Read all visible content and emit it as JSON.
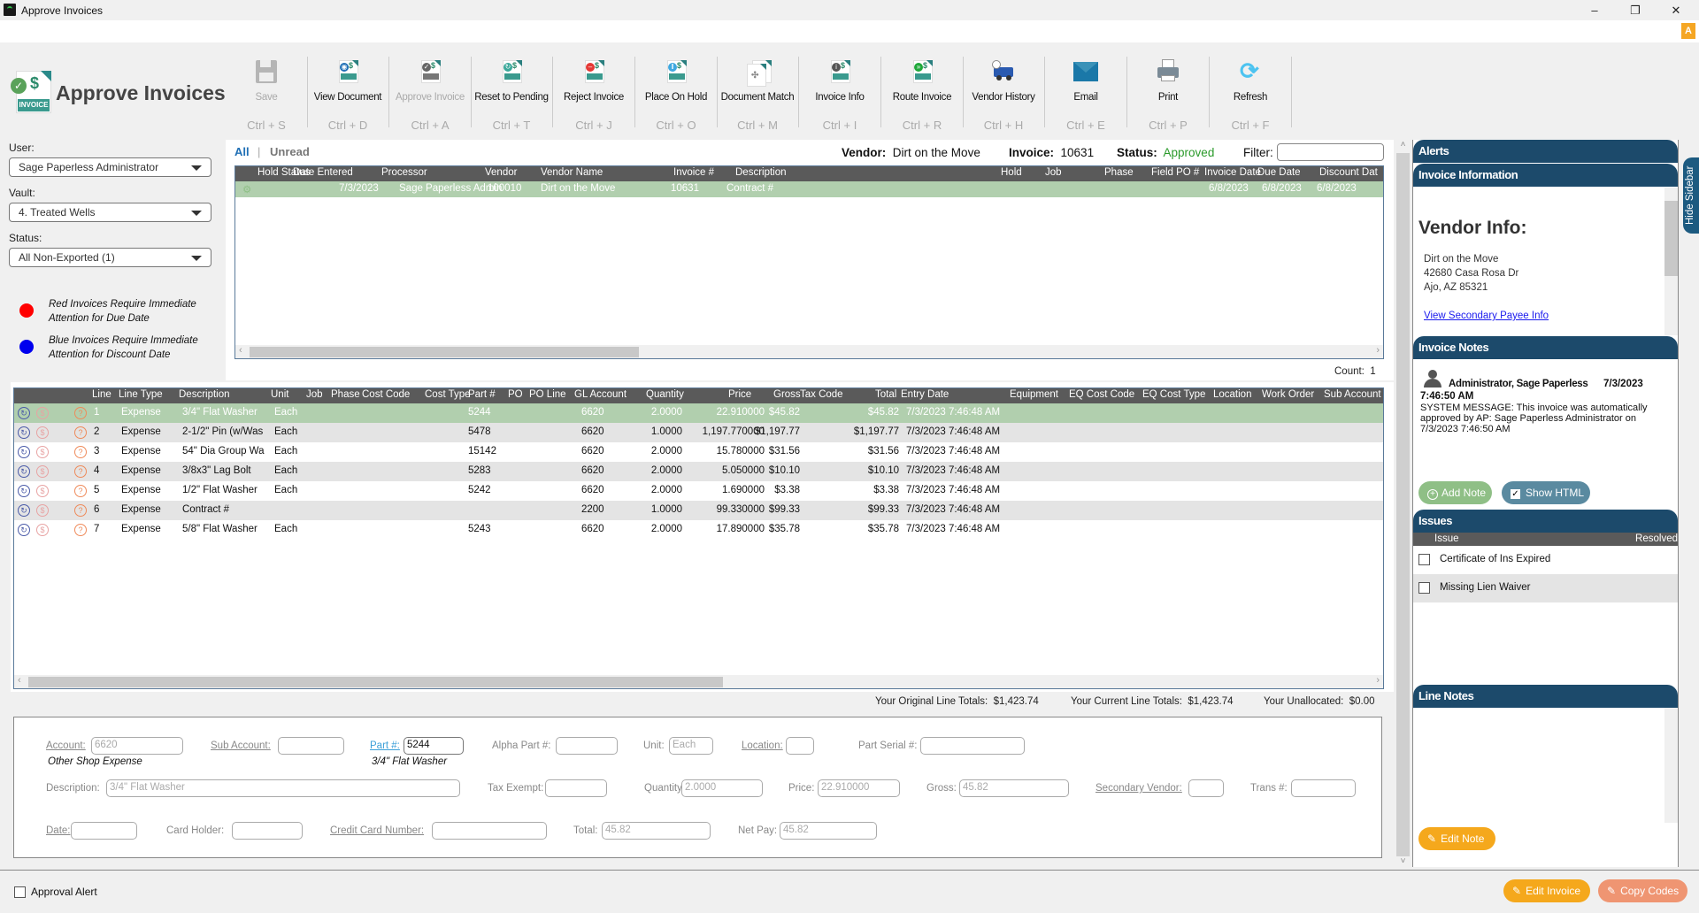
{
  "window": {
    "title": "Approve Invoices",
    "minimize": "–",
    "restore": "❐",
    "close": "✕",
    "alert_badge": "A"
  },
  "header": {
    "title": "Approve Invoices"
  },
  "toolbar": [
    {
      "label": "Save",
      "shortcut": "Ctrl + S",
      "icon": "save-icon",
      "disabled": true
    },
    {
      "label": "View Document",
      "shortcut": "Ctrl + D",
      "icon": "view-document-icon",
      "disabled": false
    },
    {
      "label": "Approve Invoice",
      "shortcut": "Ctrl + A",
      "icon": "approve-invoice-icon",
      "disabled": true
    },
    {
      "label": "Reset to Pending",
      "shortcut": "Ctrl + T",
      "icon": "reset-pending-icon",
      "disabled": false
    },
    {
      "label": "Reject Invoice",
      "shortcut": "Ctrl + J",
      "icon": "reject-invoice-icon",
      "disabled": false
    },
    {
      "label": "Place On Hold",
      "shortcut": "Ctrl + O",
      "icon": "hold-invoice-icon",
      "disabled": false
    },
    {
      "label": "Document Match",
      "shortcut": "Ctrl + M",
      "icon": "document-match-icon",
      "disabled": false
    },
    {
      "label": "Invoice Info",
      "shortcut": "Ctrl + I",
      "icon": "invoice-info-icon",
      "disabled": false
    },
    {
      "label": "Route Invoice",
      "shortcut": "Ctrl + R",
      "icon": "route-invoice-icon",
      "disabled": false
    },
    {
      "label": "Vendor History",
      "shortcut": "Ctrl + H",
      "icon": "vendor-history-icon",
      "disabled": false
    },
    {
      "label": "Email",
      "shortcut": "Ctrl + E",
      "icon": "email-icon",
      "disabled": false
    },
    {
      "label": "Print",
      "shortcut": "Ctrl + P",
      "icon": "print-icon",
      "disabled": false
    },
    {
      "label": "Refresh",
      "shortcut": "Ctrl + F",
      "icon": "refresh-icon",
      "disabled": false
    }
  ],
  "filters": {
    "user_label": "User:",
    "user_value": "Sage Paperless Administrator",
    "vault_label": "Vault:",
    "vault_value": "4. Treated Wells",
    "status_label": "Status:",
    "status_value": "All Non-Exported (1)"
  },
  "legend": [
    {
      "color": "#ff0000",
      "text": "Red Invoices Require Immediate Attention for Due Date"
    },
    {
      "color": "#0000ee",
      "text": "Blue Invoices Require Immediate Attention for Discount Date"
    }
  ],
  "tabs": {
    "all": "All",
    "separator": "|",
    "unread": "Unread"
  },
  "invoice_header": {
    "vendor_label": "Vendor:",
    "vendor_value": "Dirt on the Move",
    "invoice_label": "Invoice:",
    "invoice_value": "10631",
    "status_label": "Status:",
    "status_value": "Approved",
    "status_color": "#2a9a2a",
    "filter_label": "Filter:",
    "filter_value": ""
  },
  "invoice_grid": {
    "columns": [
      "Hold Status",
      "Date Entered",
      "Processor",
      "Vendor",
      "Vendor Name",
      "Invoice #",
      "Description",
      "Hold",
      "Job",
      "Phase",
      "Field PO #",
      "Invoice Date",
      "Due Date",
      "Discount Dat"
    ],
    "rows": [
      {
        "hold_status": "",
        "date_entered": "7/3/2023",
        "processor": "Sage Paperless Admin",
        "vendor": "100010",
        "vendor_name": "Dirt on the Move",
        "invoice_no": "10631",
        "description": "Contract #",
        "hold": "",
        "job": "",
        "phase": "",
        "field_po": "",
        "invoice_date": "6/8/2023",
        "due_date": "6/8/2023",
        "discount_date": "6/8/2023"
      }
    ],
    "count_label": "Count:",
    "count_value": "1"
  },
  "lines_grid": {
    "columns": [
      "Line",
      "Line Type",
      "Description",
      "Unit",
      "Job",
      "Phase",
      "Cost Code",
      "Cost Type",
      "Part #",
      "PO",
      "PO Line",
      "GL Account",
      "Quantity",
      "Price",
      "Gross",
      "Tax Code",
      "Total",
      "Entry Date",
      "Equipment",
      "EQ Cost Code",
      "EQ Cost Type",
      "Location",
      "Work Order",
      "Sub Account"
    ],
    "rows": [
      {
        "line": "1",
        "type": "Expense",
        "description": "3/4\" Flat Washer",
        "unit": "Each",
        "part": "5244",
        "gl": "6620",
        "qty": "2.0000",
        "price": "22.910000",
        "gross": "$45.82",
        "total": "$45.82",
        "entry": "7/3/2023 7:46:48 AM"
      },
      {
        "line": "2",
        "type": "Expense",
        "description": "2-1/2\" Pin (w/Was",
        "unit": "Each",
        "part": "5478",
        "gl": "6620",
        "qty": "1.0000",
        "price": "1,197.770000",
        "gross": "$1,197.77",
        "total": "$1,197.77",
        "entry": "7/3/2023 7:46:48 AM"
      },
      {
        "line": "3",
        "type": "Expense",
        "description": "54\" Dia Group Wa",
        "unit": "Each",
        "part": "15142",
        "gl": "6620",
        "qty": "2.0000",
        "price": "15.780000",
        "gross": "$31.56",
        "total": "$31.56",
        "entry": "7/3/2023 7:46:48 AM"
      },
      {
        "line": "4",
        "type": "Expense",
        "description": "3/8x3\" Lag Bolt",
        "unit": "Each",
        "part": "5283",
        "gl": "6620",
        "qty": "2.0000",
        "price": "5.050000",
        "gross": "$10.10",
        "total": "$10.10",
        "entry": "7/3/2023 7:46:48 AM"
      },
      {
        "line": "5",
        "type": "Expense",
        "description": "1/2\" Flat Washer",
        "unit": "Each",
        "part": "5242",
        "gl": "6620",
        "qty": "2.0000",
        "price": "1.690000",
        "gross": "$3.38",
        "total": "$3.38",
        "entry": "7/3/2023 7:46:48 AM"
      },
      {
        "line": "6",
        "type": "Expense",
        "description": "Contract #",
        "unit": "",
        "part": "",
        "gl": "2200",
        "qty": "1.0000",
        "price": "99.330000",
        "gross": "$99.33",
        "total": "$99.33",
        "entry": "7/3/2023 7:46:48 AM"
      },
      {
        "line": "7",
        "type": "Expense",
        "description": "5/8\" Flat Washer",
        "unit": "Each",
        "part": "5243",
        "gl": "6620",
        "qty": "2.0000",
        "price": "17.890000",
        "gross": "$35.78",
        "total": "$35.78",
        "entry": "7/3/2023 7:46:48 AM"
      }
    ]
  },
  "totals": {
    "original_label": "Your Original Line Totals:",
    "original_value": "$1,423.74",
    "current_label": "Your Current Line Totals:",
    "current_value": "$1,423.74",
    "unallocated_label": "Your Unallocated:",
    "unallocated_value": "$0.00"
  },
  "detail": {
    "account_label": "Account:",
    "account_value": "6620",
    "account_desc": "Other Shop Expense",
    "sub_account_label": "Sub Account:",
    "sub_account_value": "",
    "part_label": "Part #:",
    "part_value": "5244",
    "part_desc": "3/4\" Flat Washer",
    "alpha_part_label": "Alpha Part #:",
    "alpha_part_value": "",
    "unit_label": "Unit:",
    "unit_value": "Each",
    "location_label": "Location:",
    "location_value": "",
    "part_serial_label": "Part Serial #:",
    "part_serial_value": "",
    "description_label": "Description:",
    "description_value": "3/4\" Flat Washer",
    "tax_exempt_label": "Tax Exempt:",
    "tax_exempt_value": "",
    "quantity_label": "Quantity:",
    "quantity_value": "2.0000",
    "price_label": "Price:",
    "price_value": "22.910000",
    "gross_label": "Gross:",
    "gross_value": "45.82",
    "secondary_vendor_label": "Secondary Vendor:",
    "secondary_vendor_value": "",
    "trans_label": "Trans #:",
    "trans_value": "",
    "date_label": "Date:",
    "date_value": "",
    "card_holder_label": "Card Holder:",
    "card_holder_value": "",
    "cc_number_label": "Credit Card Number:",
    "cc_number_value": "",
    "total_label": "Total:",
    "total_value": "45.82",
    "net_pay_label": "Net Pay:",
    "net_pay_value": "45.82"
  },
  "sidebar": {
    "alerts_title": "Alerts",
    "invoice_info_title": "Invoice Information",
    "vendor_info_title": "Vendor Info:",
    "vendor_name": "Dirt on the Move",
    "vendor_address1": "42680 Casa Rosa Dr",
    "vendor_address2": "Ajo, AZ 85321",
    "vendor_link": "View Secondary Payee Info",
    "notes_title": "Invoice Notes",
    "note_author": "Administrator, Sage Paperless",
    "note_date": "7/3/2023",
    "note_time": "7:46:50 AM",
    "note_text": "SYSTEM MESSAGE: This invoice was automatically approved by AP: Sage Paperless Administrator on 7/3/2023 7:46:50 AM",
    "add_note": "Add Note",
    "show_html": "Show HTML",
    "show_html_checked": true,
    "issues_title": "Issues",
    "issues_col_issue": "Issue",
    "issues_col_resolved": "Resolved",
    "issues": [
      {
        "text": "Certificate of Ins Expired",
        "resolved": false
      },
      {
        "text": "Missing Lien Waiver",
        "resolved": false
      }
    ],
    "line_notes_title": "Line Notes",
    "edit_note": "Edit Note",
    "hide_sidebar": "Hide Sidebar"
  },
  "footer": {
    "approval_alert": "Approval Alert",
    "approval_alert_checked": false,
    "edit_invoice": "Edit Invoice",
    "copy_codes": "Copy Codes"
  }
}
